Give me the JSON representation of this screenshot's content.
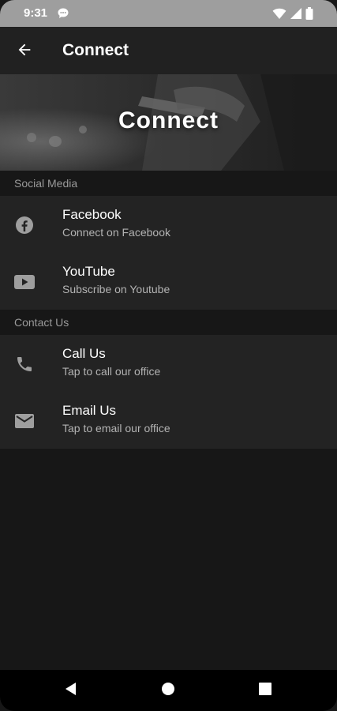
{
  "status_bar": {
    "time": "9:31",
    "icons": [
      "chat-bubble-icon",
      "wifi-icon",
      "signal-icon",
      "battery-icon"
    ]
  },
  "app_bar": {
    "back_icon": "arrow-back-icon",
    "title": "Connect"
  },
  "banner": {
    "title": "Connect"
  },
  "sections": [
    {
      "header": "Social Media",
      "items": [
        {
          "icon": "facebook-icon",
          "title": "Facebook",
          "subtitle": "Connect on Facebook"
        },
        {
          "icon": "youtube-icon",
          "title": "YouTube",
          "subtitle": "Subscribe on Youtube"
        }
      ]
    },
    {
      "header": "Contact Us",
      "items": [
        {
          "icon": "phone-icon",
          "title": "Call Us",
          "subtitle": "Tap to call our office"
        },
        {
          "icon": "mail-icon",
          "title": "Email Us",
          "subtitle": "Tap to email our office"
        }
      ]
    }
  ],
  "nav_bar": {
    "icons": [
      "back-triangle-icon",
      "home-circle-icon",
      "recents-square-icon"
    ]
  },
  "colors": {
    "background": "#171717",
    "surface": "#232323",
    "app_bar": "#212121",
    "status_bar": "#9e9e9e",
    "text_primary": "#ffffff",
    "text_secondary": "#b3b3b3",
    "icon": "#9e9e9e"
  }
}
